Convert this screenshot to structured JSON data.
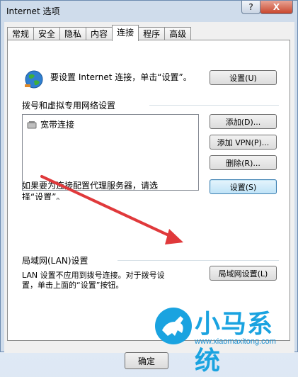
{
  "window": {
    "title": "Internet 选项",
    "help_label": "?",
    "close_label": "X"
  },
  "tabs": [
    {
      "label": "常规"
    },
    {
      "label": "安全"
    },
    {
      "label": "隐私"
    },
    {
      "label": "内容"
    },
    {
      "label": "连接",
      "active": true
    },
    {
      "label": "程序"
    },
    {
      "label": "高级"
    }
  ],
  "connection": {
    "setup_text": "要设置 Internet 连接，单击“设置”。",
    "setup_button": "设置(U)"
  },
  "dialup": {
    "heading": "拨号和虚拟专用网络设置",
    "items": [
      {
        "label": "宽带连接"
      }
    ],
    "add_button": "添加(D)...",
    "add_vpn_button": "添加 VPN(P)...",
    "remove_button": "删除(R)...",
    "proxy_text": "如果要为连接配置代理服务器，请选择“设置”。",
    "settings_button": "设置(S)"
  },
  "lan": {
    "heading": "局域网(LAN)设置",
    "description_line1": "LAN 设置不应用到拨号连接。对于拨号设",
    "description_line2": "置，单击上面的“设置”按钮。",
    "lan_button": "局域网设置(L)"
  },
  "footer": {
    "ok_button": "确定"
  },
  "watermark": {
    "brand": "小马系统",
    "url": "www.xiaomaxitong.com"
  },
  "colors": {
    "watermark": "#1aa3e0",
    "annotation_arrow": "#e0393b"
  }
}
